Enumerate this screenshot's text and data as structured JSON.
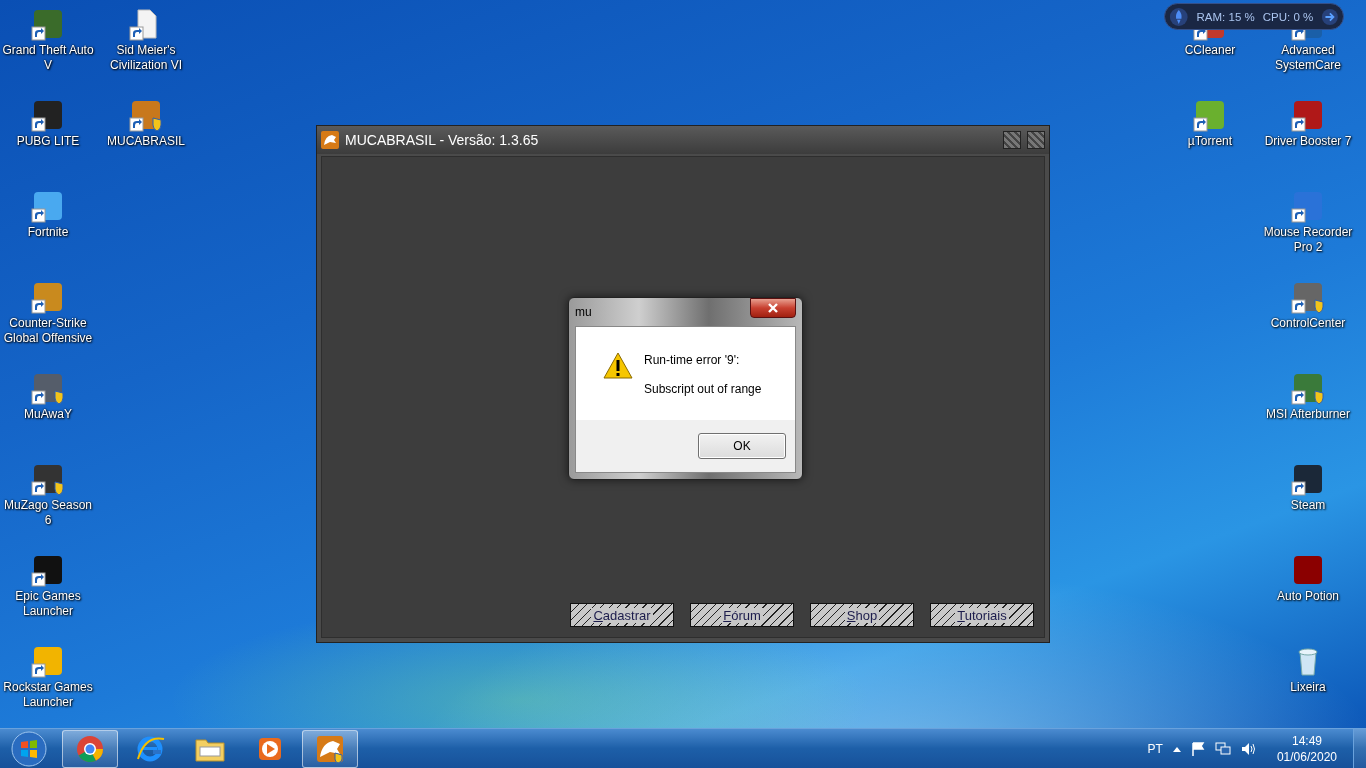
{
  "desktop": {
    "left_columns": [
      [
        {
          "label": "Grand Theft Auto V",
          "kind": "app",
          "shortcut": true,
          "shield": false
        },
        {
          "label": "PUBG LITE",
          "kind": "app",
          "shortcut": true,
          "shield": false
        },
        {
          "label": "Fortnite",
          "kind": "app",
          "shortcut": true,
          "shield": false
        },
        {
          "label": "Counter-Strike Global Offensive",
          "kind": "app",
          "shortcut": true,
          "shield": false
        },
        {
          "label": "MuAwaY",
          "kind": "app",
          "shortcut": true,
          "shield": true
        },
        {
          "label": "MuZago Season 6",
          "kind": "app",
          "shortcut": true,
          "shield": true
        },
        {
          "label": "Epic Games Launcher",
          "kind": "app",
          "shortcut": true,
          "shield": false
        },
        {
          "label": "Rockstar Games Launcher",
          "kind": "app",
          "shortcut": true,
          "shield": false
        }
      ],
      [
        {
          "label": "Sid Meier's Civilization VI",
          "kind": "file",
          "shortcut": true,
          "shield": false
        },
        {
          "label": "MUCABRASIL",
          "kind": "app",
          "shortcut": true,
          "shield": true
        }
      ]
    ],
    "right_columns": [
      [
        {
          "label": "CCleaner",
          "kind": "app",
          "shortcut": true,
          "shield": false
        },
        {
          "label": "µTorrent",
          "kind": "app",
          "shortcut": true,
          "shield": false
        }
      ],
      [
        {
          "label": "Advanced SystemCare",
          "kind": "app",
          "shortcut": true,
          "shield": false
        },
        {
          "label": "Driver Booster 7",
          "kind": "app",
          "shortcut": true,
          "shield": false
        },
        {
          "label": "Mouse Recorder Pro 2",
          "kind": "app",
          "shortcut": true,
          "shield": false
        },
        {
          "label": "ControlCenter",
          "kind": "app",
          "shortcut": true,
          "shield": true
        },
        {
          "label": "MSI Afterburner",
          "kind": "app",
          "shortcut": true,
          "shield": true
        },
        {
          "label": "Steam",
          "kind": "app",
          "shortcut": true,
          "shield": false
        },
        {
          "label": "Auto Potion",
          "kind": "app",
          "shortcut": false,
          "shield": false
        },
        {
          "label": "Lixeira",
          "kind": "recycle-bin",
          "shortcut": false,
          "shield": false
        }
      ]
    ]
  },
  "gadget": {
    "ram": "RAM: 15 %",
    "cpu": "CPU: 0 %"
  },
  "launcher": {
    "title": "MUCABRASIL - Versão: 1.3.65",
    "buttons": [
      "Cadastrar",
      "Fórum",
      "Shop",
      "Tutoriais"
    ]
  },
  "dialog": {
    "title": "mu",
    "messages": [
      "Run-time error '9':",
      "Subscript out of range"
    ],
    "button": "OK"
  },
  "taskbar": {
    "items": [
      {
        "kind": "chrome",
        "running": true
      },
      {
        "kind": "browser",
        "running": false
      },
      {
        "kind": "folder",
        "running": false
      },
      {
        "kind": "media",
        "running": false
      },
      {
        "kind": "game",
        "running": true
      }
    ],
    "language": "PT",
    "time": "14:49",
    "date": "01/06/2020"
  }
}
